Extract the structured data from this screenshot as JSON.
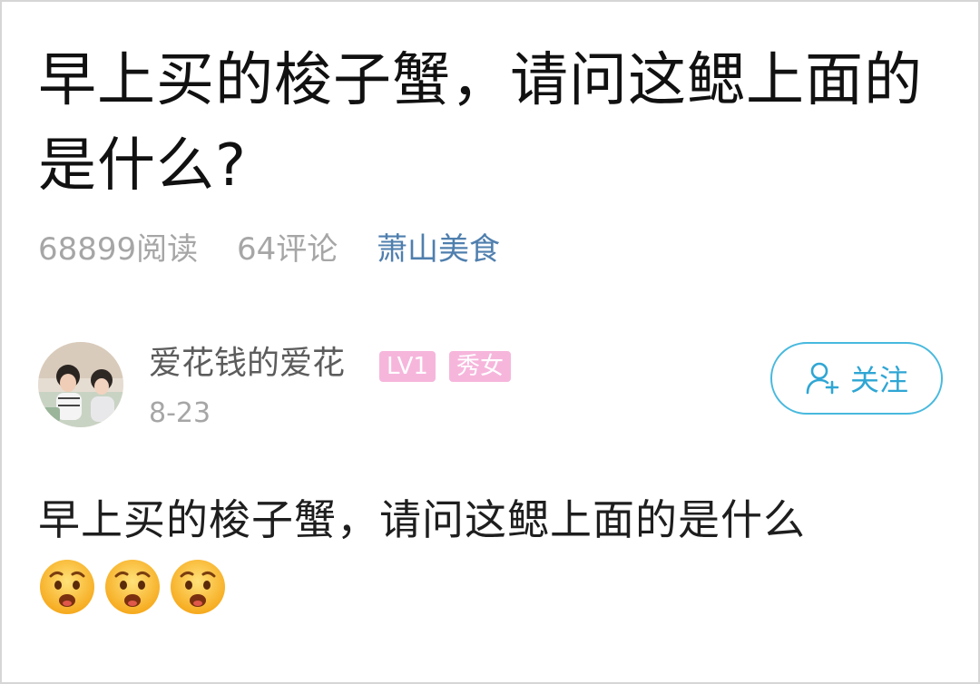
{
  "post": {
    "title": "早上买的梭子蟹，请问这鳃上面的是什么?",
    "views": "68899阅读",
    "comments": "64评论",
    "topic": "萧山美食"
  },
  "author": {
    "name": "爱花钱的爱花",
    "level": "LV1",
    "tag": "秀女",
    "date": "8-23",
    "follow_label": "关注"
  },
  "content": {
    "text": "早上买的梭子蟹，请问这鳃上面的是什么",
    "emojis": [
      "worried-face-icon",
      "worried-face-icon",
      "worried-face-icon"
    ]
  },
  "colors": {
    "accent": "#48b9de",
    "badge": "#f6b6dc",
    "topic": "#4f7fae",
    "meta": "#a6a6a6"
  }
}
